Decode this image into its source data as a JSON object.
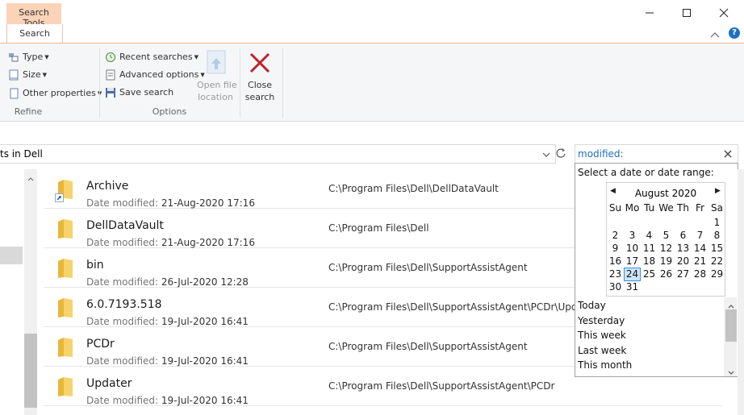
{
  "titlebar": {
    "context_tab": "Search Tools",
    "active_tab": "Search",
    "minimize_icon": "minimize-icon",
    "maximize_icon": "maximize-icon",
    "close_icon": "close-icon",
    "collapse_icon": "chevron-up-icon",
    "help_icon": "help-icon"
  },
  "ribbon": {
    "refine": {
      "type_label": "Type",
      "size_label": "Size",
      "other_label": "Other properties",
      "group_label": "Refine"
    },
    "options": {
      "recent_label": "Recent searches",
      "advanced_label": "Advanced options",
      "save_label": "Save search",
      "open_loc_line1": "Open file",
      "open_loc_line2": "location",
      "group_label": "Options"
    },
    "close": {
      "line1": "Close",
      "line2": "search"
    }
  },
  "address": {
    "text": "ts in Dell",
    "dropdown_icon": "chevron-down-icon",
    "refresh_icon": "refresh-icon"
  },
  "search": {
    "value": "modified:",
    "clear_icon": "close-icon"
  },
  "files": [
    {
      "name": "Archive",
      "date_label": "Date modified:",
      "date": "21-Aug-2020 17:16",
      "path": "C:\\Program Files\\Dell\\DellDataVault",
      "shortcut": true
    },
    {
      "name": "DellDataVault",
      "date_label": "Date modified:",
      "date": "21-Aug-2020 17:16",
      "path": "C:\\Program Files\\Dell",
      "shortcut": false
    },
    {
      "name": "bin",
      "date_label": "Date modified:",
      "date": "26-Jul-2020 12:28",
      "path": "C:\\Program Files\\Dell\\SupportAssistAgent",
      "shortcut": false
    },
    {
      "name": "6.0.7193.518",
      "date_label": "Date modified:",
      "date": "19-Jul-2020 16:41",
      "path": "C:\\Program Files\\Dell\\SupportAssistAgent\\PCDr\\Updater",
      "shortcut": false
    },
    {
      "name": "PCDr",
      "date_label": "Date modified:",
      "date": "19-Jul-2020 16:41",
      "path": "C:\\Program Files\\Dell\\SupportAssistAgent",
      "shortcut": false
    },
    {
      "name": "Updater",
      "date_label": "Date modified:",
      "date": "19-Jul-2020 16:41",
      "path": "C:\\Program Files\\Dell\\SupportAssistAgent\\PCDr",
      "shortcut": false
    }
  ],
  "picker": {
    "prompt": "Select a date or date range:",
    "month": "August 2020",
    "weekdays": [
      "Su",
      "Mo",
      "Tu",
      "We",
      "Th",
      "Fr",
      "Sa"
    ],
    "weeks": [
      [
        "",
        "",
        "",
        "",
        "",
        "",
        "1"
      ],
      [
        "2",
        "3",
        "4",
        "5",
        "6",
        "7",
        "8"
      ],
      [
        "9",
        "10",
        "11",
        "12",
        "13",
        "14",
        "15"
      ],
      [
        "16",
        "17",
        "18",
        "19",
        "20",
        "21",
        "22"
      ],
      [
        "23",
        "24",
        "25",
        "26",
        "27",
        "28",
        "29"
      ],
      [
        "30",
        "31",
        "",
        "",
        "",
        "",
        ""
      ]
    ],
    "today": "24",
    "quick_ranges": [
      "Today",
      "Yesterday",
      "This week",
      "Last week",
      "This month"
    ]
  },
  "colors": {
    "context_tab": "#fbd3b8",
    "accent": "#1e6fbf",
    "close_red": "#c0202a",
    "folder_yellow": "#f3c94f"
  }
}
